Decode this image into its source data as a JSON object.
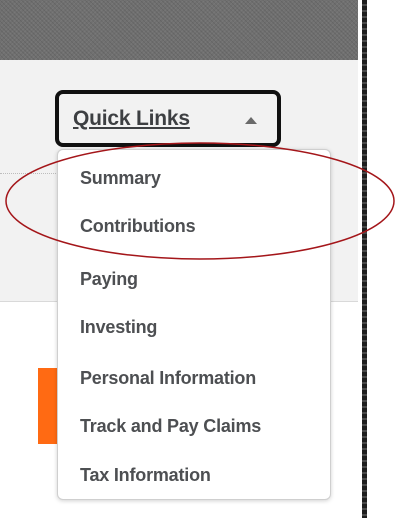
{
  "quick_links": {
    "label": "Quick Links",
    "menu": [
      {
        "label": "Summary"
      },
      {
        "label": "Contributions"
      },
      {
        "label": "Paying"
      },
      {
        "label": "Investing"
      },
      {
        "label": "Personal Information"
      },
      {
        "label": "Track and Pay Claims"
      },
      {
        "label": "Tax Information"
      }
    ]
  },
  "colors": {
    "accent_orange": "#ff6a13",
    "annotation_red": "#a4161a",
    "menu_text": "#4d4f52"
  },
  "icons": {
    "dropdown_caret": "caret-up-icon"
  }
}
